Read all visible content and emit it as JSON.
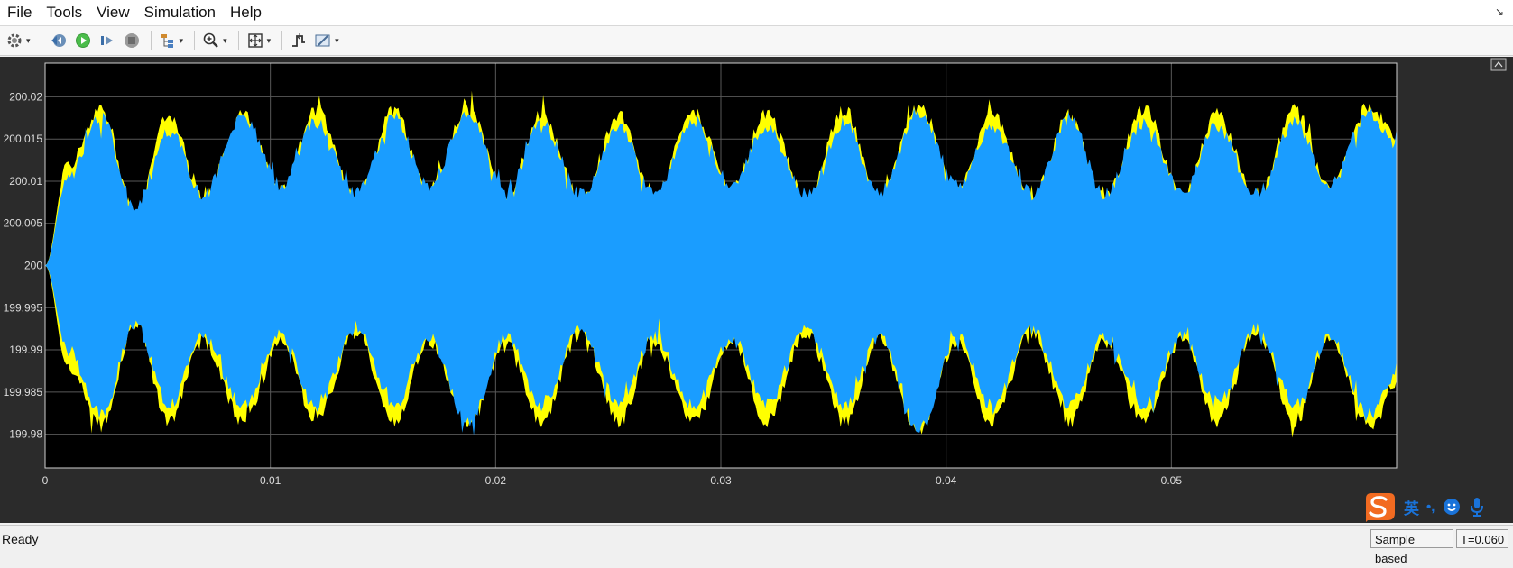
{
  "menu": [
    "File",
    "Tools",
    "View",
    "Simulation",
    "Help"
  ],
  "toolbar": {
    "icons": [
      "gear-icon",
      "step-back-icon",
      "run-icon",
      "step-forward-icon",
      "stop-icon",
      "signal-hierarchy-icon",
      "zoom-in-icon",
      "fit-to-view-icon",
      "triggers-icon",
      "cursor-measurements-icon"
    ]
  },
  "colors": {
    "plot_background": "#000000",
    "figure_background": "#2b2b2b",
    "series_yellow": "#ffff00",
    "series_blue": "#1a9dff",
    "grid": "#595959",
    "tick_label": "#dddddd"
  },
  "chart_data": {
    "type": "line",
    "title": "",
    "xlabel": "",
    "ylabel": "",
    "xlim": [
      0,
      0.06
    ],
    "ylim": [
      199.976,
      200.024
    ],
    "grid": true,
    "x_ticks": [
      0,
      0.01,
      0.02,
      0.03,
      0.04,
      0.05
    ],
    "x_tick_labels": [
      "0",
      "0.01",
      "0.02",
      "0.03",
      "0.04",
      "0.05"
    ],
    "y_ticks": [
      199.98,
      199.985,
      199.99,
      199.995,
      200,
      200.005,
      200.01,
      200.015,
      200.02
    ],
    "y_tick_labels": [
      "199.98",
      "199.985",
      "199.99",
      "199.995",
      "200",
      "200.005",
      "200.01",
      "200.015",
      "200.02"
    ],
    "series": [
      {
        "color": "yellow",
        "envelope_x": [
          0,
          0.001,
          0.0025,
          0.004,
          0.0055,
          0.007,
          0.0088,
          0.0105,
          0.012,
          0.0138,
          0.0155,
          0.017,
          0.0188,
          0.0205,
          0.022,
          0.0238,
          0.0255,
          0.027,
          0.0288,
          0.0305,
          0.032,
          0.0338,
          0.0355,
          0.037,
          0.0388,
          0.0405,
          0.042,
          0.0438,
          0.0455,
          0.047,
          0.0488,
          0.0505,
          0.052,
          0.0538,
          0.0555,
          0.057,
          0.0588,
          0.06
        ],
        "upper": [
          200.0,
          200.012,
          200.0185,
          200.006,
          200.018,
          200.008,
          200.018,
          200.009,
          200.0185,
          200.008,
          200.0185,
          200.009,
          200.019,
          200.008,
          200.018,
          200.008,
          200.018,
          200.008,
          200.018,
          200.009,
          200.018,
          200.008,
          200.0185,
          200.008,
          200.019,
          200.009,
          200.018,
          200.008,
          200.018,
          200.008,
          200.0185,
          200.008,
          200.018,
          200.008,
          200.0185,
          200.009,
          200.019,
          200.015
        ],
        "lower": [
          200.0,
          199.988,
          199.981,
          199.993,
          199.9815,
          199.991,
          199.9815,
          199.991,
          199.9815,
          199.992,
          199.9815,
          199.991,
          199.9815,
          199.991,
          199.9815,
          199.992,
          199.9815,
          199.991,
          199.9815,
          199.991,
          199.9815,
          199.992,
          199.9815,
          199.991,
          199.9805,
          199.991,
          199.9815,
          199.992,
          199.9815,
          199.991,
          199.9815,
          199.991,
          199.9815,
          199.992,
          199.9815,
          199.991,
          199.981,
          199.986
        ]
      },
      {
        "color": "blue",
        "envelope_x": [
          0,
          0.001,
          0.0025,
          0.004,
          0.0055,
          0.007,
          0.0088,
          0.0105,
          0.012,
          0.0138,
          0.0155,
          0.017,
          0.0188,
          0.0205,
          0.022,
          0.0238,
          0.0255,
          0.027,
          0.0288,
          0.0305,
          0.032,
          0.0338,
          0.0355,
          0.037,
          0.0388,
          0.0405,
          0.042,
          0.0438,
          0.0455,
          0.047,
          0.0488,
          0.0505,
          0.052,
          0.0538,
          0.0555,
          0.057,
          0.0588,
          0.06
        ],
        "upper": [
          200.0,
          200.0105,
          200.0175,
          200.007,
          200.016,
          200.0085,
          200.0175,
          200.0095,
          200.017,
          200.0085,
          200.0175,
          200.0095,
          200.018,
          200.0085,
          200.017,
          200.0085,
          200.0165,
          200.0085,
          200.017,
          200.0095,
          200.0165,
          200.0085,
          200.017,
          200.0085,
          200.018,
          200.0095,
          200.0165,
          200.0085,
          200.0175,
          200.0085,
          200.017,
          200.0085,
          200.0165,
          200.0085,
          200.017,
          200.0095,
          200.018,
          200.014
        ],
        "lower": [
          200.0,
          199.99,
          199.9825,
          199.993,
          199.9835,
          199.9915,
          199.9835,
          199.9915,
          199.983,
          199.9925,
          199.9835,
          199.9915,
          199.9815,
          199.9915,
          199.9835,
          199.9925,
          199.9835,
          199.9915,
          199.9835,
          199.9915,
          199.9835,
          199.9925,
          199.9835,
          199.9915,
          199.9805,
          199.9915,
          199.9835,
          199.9925,
          199.9835,
          199.9915,
          199.9835,
          199.9915,
          199.9835,
          199.9925,
          199.9835,
          199.9915,
          199.982,
          199.987
        ]
      }
    ]
  },
  "status": {
    "ready": "Ready",
    "mode": "Sample based",
    "time": "T=0.060"
  },
  "ime": {
    "lang": "英",
    "punct": "•,"
  }
}
